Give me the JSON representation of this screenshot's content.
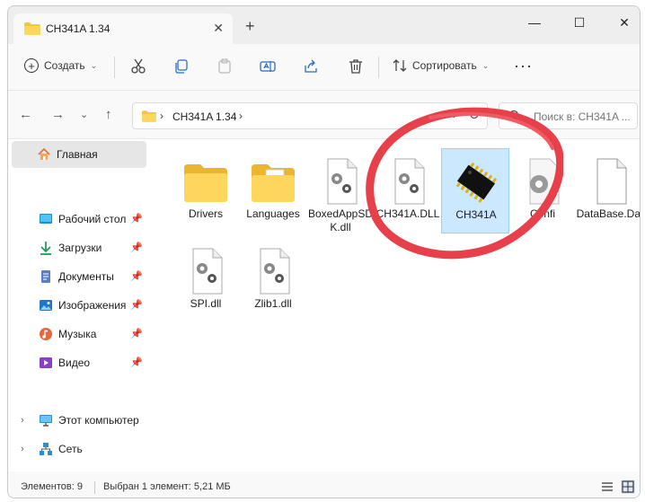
{
  "window": {
    "tab_title": "CH341A 1.34",
    "tab_close_icon": "✕",
    "new_tab_icon": "+",
    "minimize_icon": "—",
    "maximize_icon": "☐",
    "close_icon": "✕"
  },
  "commandbar": {
    "create_label": "Создать",
    "sort_label": "Сортировать",
    "more_label": "···"
  },
  "address": {
    "crumb": "CH341A 1.34",
    "search_placeholder": "Поиск в: CH341A ..."
  },
  "sidebar": {
    "home": "Главная",
    "items": [
      {
        "label": "Рабочий стол",
        "icon": "desktop-icon"
      },
      {
        "label": "Загрузки",
        "icon": "downloads-icon"
      },
      {
        "label": "Документы",
        "icon": "documents-icon"
      },
      {
        "label": "Изображения",
        "icon": "pictures-icon"
      },
      {
        "label": "Музыка",
        "icon": "music-icon"
      },
      {
        "label": "Видео",
        "icon": "video-icon"
      }
    ],
    "computer": "Этот компьютер",
    "network": "Сеть"
  },
  "files": [
    {
      "name": "Drivers",
      "type": "folder"
    },
    {
      "name": "Languages",
      "type": "folder"
    },
    {
      "name": "BoxedAppSDK.dll",
      "type": "dll"
    },
    {
      "name": "CH341A.DLL",
      "type": "dll"
    },
    {
      "name": "CH341A",
      "type": "exe",
      "selected": true
    },
    {
      "name": "Confi",
      "type": "config"
    },
    {
      "name": "DataBase.Dat",
      "type": "file"
    },
    {
      "name": "SPI.dll",
      "type": "dll"
    },
    {
      "name": "Zlib1.dll",
      "type": "dll"
    }
  ],
  "status": {
    "items_count": "Элементов: 9",
    "selected": "Выбран 1 элемент: 5,21 МБ"
  },
  "colors": {
    "accent": "#0067c0",
    "selection": "#cce8ff",
    "annotation": "#e8404a"
  }
}
